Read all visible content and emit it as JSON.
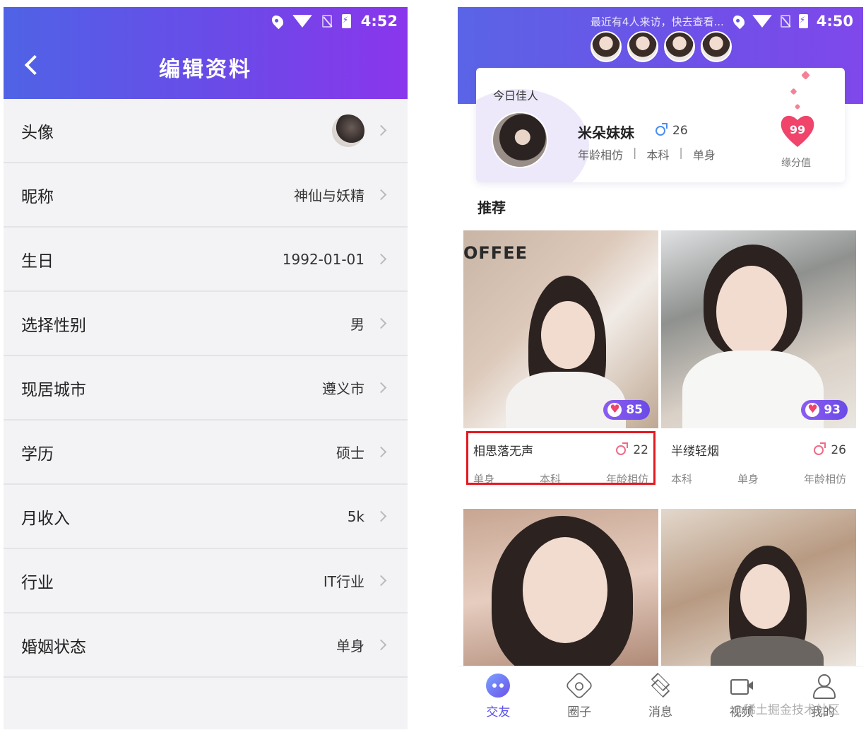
{
  "left": {
    "status": {
      "time": "4:52"
    },
    "header": {
      "title": "编辑资料"
    },
    "rows": [
      {
        "label": "头像",
        "value": ""
      },
      {
        "label": "昵称",
        "value": "神仙与妖精"
      },
      {
        "label": "生日",
        "value": "1992-01-01"
      },
      {
        "label": "选择性别",
        "value": "男"
      },
      {
        "label": "现居城市",
        "value": "遵义市"
      },
      {
        "label": "学历",
        "value": "硕士"
      },
      {
        "label": "月收入",
        "value": "5k"
      },
      {
        "label": "行业",
        "value": "IT行业"
      },
      {
        "label": "婚姻状态",
        "value": "单身"
      }
    ]
  },
  "right": {
    "status": {
      "time": "4:50",
      "notice": "最近有4人来访，快去查看..."
    },
    "today": {
      "label": "今日佳人",
      "name": "米朵妹妹",
      "age": "26",
      "tags": [
        "年龄相仿",
        "本科",
        "单身"
      ],
      "separator": "|",
      "score": "99",
      "score_label": "缘分值"
    },
    "recommend_title": "推荐",
    "cards": [
      {
        "name": "相思落无声",
        "age": "22",
        "score": "85",
        "tags": [
          "单身",
          "本科",
          "年龄相仿"
        ],
        "photo_text": "OFFEE"
      },
      {
        "name": "半缕轻烟",
        "age": "26",
        "score": "93",
        "tags": [
          "本科",
          "单身",
          "年龄相仿"
        ]
      }
    ],
    "tabs": [
      {
        "label": "交友",
        "icon": "chat-icon"
      },
      {
        "label": "圈子",
        "icon": "circle-icon"
      },
      {
        "label": "消息",
        "icon": "layers-icon"
      },
      {
        "label": "视频",
        "icon": "video-icon"
      },
      {
        "label": "我的",
        "icon": "user-icon"
      }
    ],
    "watermark": "@稀土掘金技术社区"
  },
  "colors": {
    "accent": "#6a4be8",
    "highlight": "#e5191f",
    "heart": "#f0446a"
  }
}
